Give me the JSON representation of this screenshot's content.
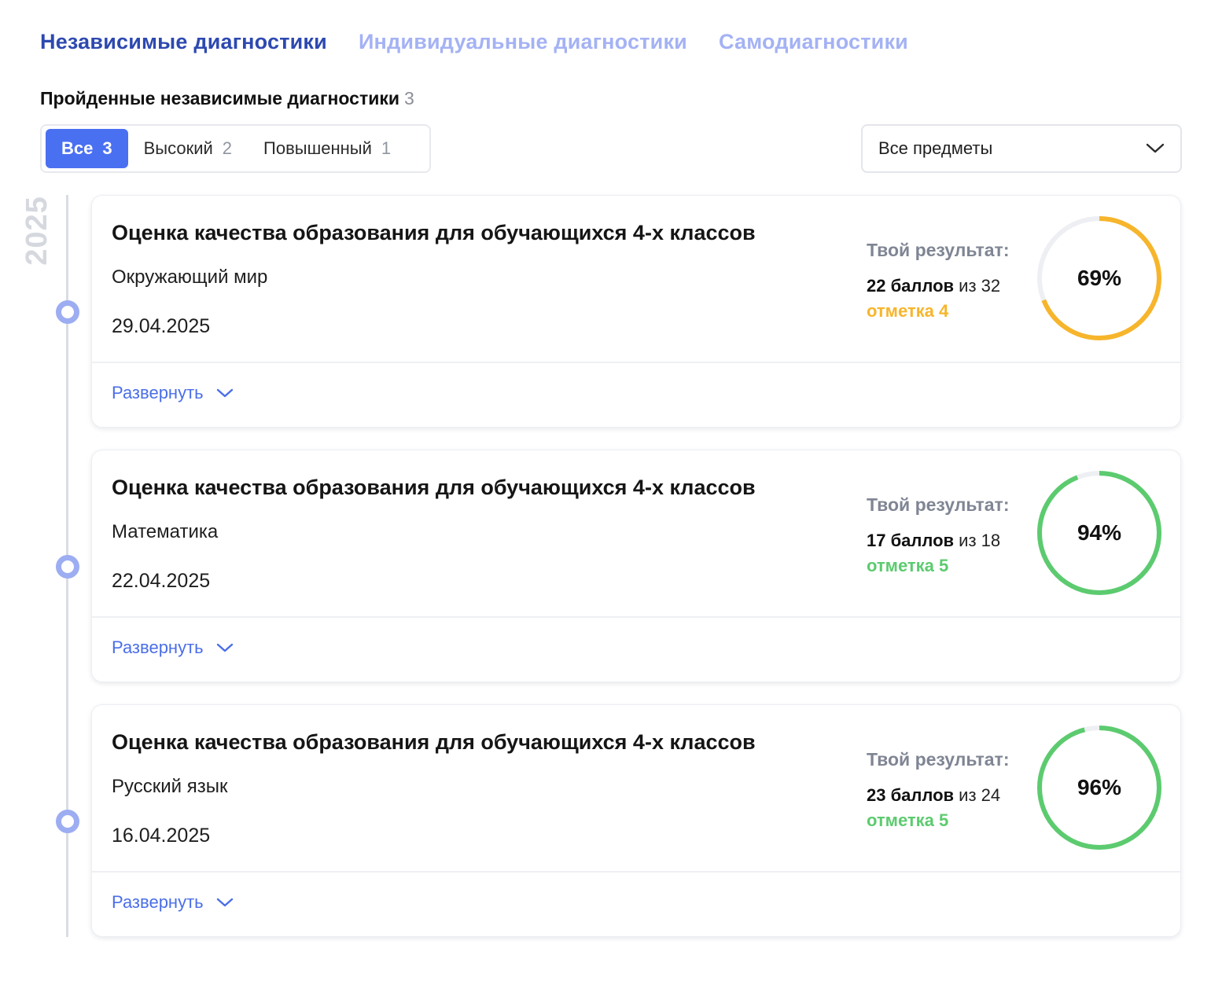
{
  "tabs": [
    {
      "label": "Независимые диагностики",
      "active": true
    },
    {
      "label": "Индивидуальные диагностики",
      "active": false
    },
    {
      "label": "Самодиагностики",
      "active": false
    }
  ],
  "section": {
    "title": "Пройденные независимые диагностики",
    "count": "3"
  },
  "filters": [
    {
      "label": "Все",
      "count": "3",
      "active": true
    },
    {
      "label": "Высокий",
      "count": "2",
      "active": false
    },
    {
      "label": "Повышенный",
      "count": "1",
      "active": false
    }
  ],
  "subject_select": {
    "value": "Все предметы",
    "icon": "chevron-down-icon"
  },
  "timeline": {
    "year": "2025"
  },
  "colors": {
    "accent": "#4a70f2",
    "tab_active": "#2d49b0",
    "tab_inactive": "#a4b2f4",
    "grade4": "#f7b52c",
    "grade5": "#5ccb6f",
    "ring_track": "#eeeff3"
  },
  "cards": [
    {
      "title": "Оценка качества образования для обучающихся 4-х классов",
      "subject": "Окружающий мир",
      "date": "29.04.2025",
      "result_label": "Твой результат:",
      "points": "22 баллов",
      "points_of": "из 32",
      "grade": "отметка 4",
      "grade_color": "#f7b52c",
      "percent_value": 69,
      "percent": "69%",
      "expand_label": "Развернуть"
    },
    {
      "title": "Оценка качества образования для обучающихся 4-х классов",
      "subject": "Математика",
      "date": "22.04.2025",
      "result_label": "Твой результат:",
      "points": "17 баллов",
      "points_of": "из 18",
      "grade": "отметка 5",
      "grade_color": "#5ccb6f",
      "percent_value": 94,
      "percent": "94%",
      "expand_label": "Развернуть"
    },
    {
      "title": "Оценка качества образования для обучающихся 4-х классов",
      "subject": "Русский язык",
      "date": "16.04.2025",
      "result_label": "Твой результат:",
      "points": "23 баллов",
      "points_of": "из 24",
      "grade": "отметка 5",
      "grade_color": "#5ccb6f",
      "percent_value": 96,
      "percent": "96%",
      "expand_label": "Развернуть"
    }
  ]
}
